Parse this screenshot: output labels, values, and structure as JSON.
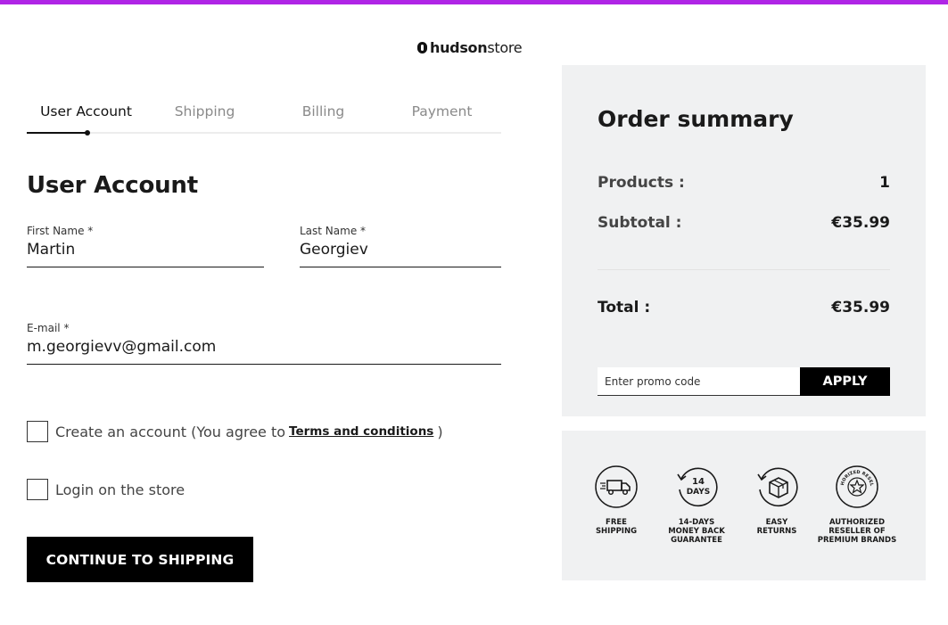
{
  "brand": {
    "bold": "hudson",
    "light": "store"
  },
  "tabs": [
    {
      "label": "User Account",
      "active": true
    },
    {
      "label": "Shipping",
      "active": false
    },
    {
      "label": "Billing",
      "active": false
    },
    {
      "label": "Payment",
      "active": false
    }
  ],
  "form": {
    "title": "User Account",
    "first_name": {
      "label": "First Name *",
      "value": "Martin"
    },
    "last_name": {
      "label": "Last Name *",
      "value": "Georgiev"
    },
    "email": {
      "label": "E-mail *",
      "value": "m.georgievv@gmail.com"
    },
    "create_account": {
      "text": "Create an account (You agree to",
      "link": "Terms and conditions",
      "close": ")"
    },
    "login": {
      "text": "Login on the store"
    },
    "continue_label": "CONTINUE TO SHIPPING"
  },
  "summary": {
    "title": "Order summary",
    "products": {
      "label": "Products :",
      "value": "1"
    },
    "subtotal": {
      "label": "Subtotal :",
      "value": "€35.99"
    },
    "total": {
      "label": "Total :",
      "value": "€35.99"
    },
    "promo_placeholder": "Enter promo code",
    "apply_label": "APPLY"
  },
  "perks": [
    {
      "icon": "truck-icon",
      "line1": "FREE",
      "line2": "SHIPPING",
      "line3": ""
    },
    {
      "icon": "calendar-14-icon",
      "line1": "14-DAYS",
      "line2": "MONEY BACK",
      "line3": "GUARANTEE",
      "badge_top": "14",
      "badge_bottom": "DAYS"
    },
    {
      "icon": "box-return-icon",
      "line1": "EASY",
      "line2": "RETURNS",
      "line3": ""
    },
    {
      "icon": "star-seal-icon",
      "line1": "AUTHORIZED",
      "line2": "RESELLER OF",
      "line3": "PREMIUM BRANDS",
      "seal_text": "AUTHORIZED RESELLER"
    }
  ],
  "colors": {
    "accent": "#b025e6",
    "panel": "#f0f1f2",
    "button": "#000000"
  }
}
